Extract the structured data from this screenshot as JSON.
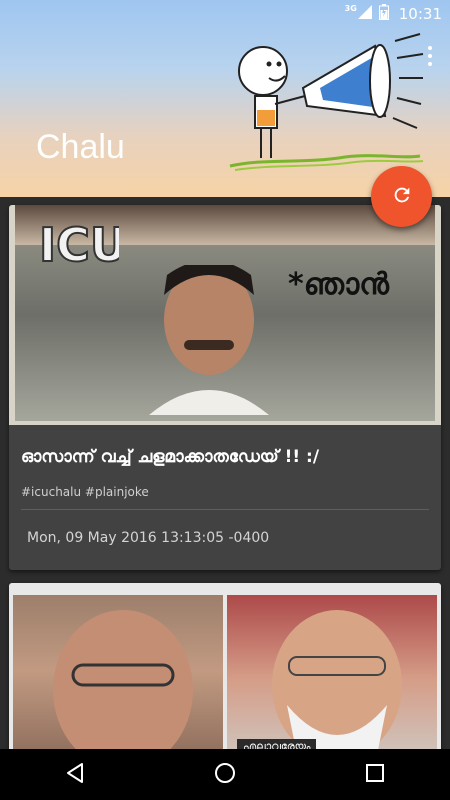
{
  "status_bar": {
    "network_label": "3G",
    "time": "10:31"
  },
  "header": {
    "title": "Chalu",
    "mascot_icon": "megaphone-mascot",
    "menu_icon": "overflow-menu-icon"
  },
  "fab": {
    "icon": "refresh-icon",
    "color": "#f0542c"
  },
  "posts": [
    {
      "image_text": "*ഞാൻ",
      "caption": "ഓസാന്ന് വച്ച് ചളമാക്കാതഡേയ് !! :/",
      "tags": "#icuchalu #plainjoke",
      "timestamp": "Mon, 09 May 2016 13:13:05 -0400"
    },
    {
      "image_text": "എല്ലാവരേയും"
    }
  ],
  "nav_bar": {
    "back_icon": "back-icon",
    "home_icon": "home-icon",
    "recents_icon": "recents-icon"
  }
}
